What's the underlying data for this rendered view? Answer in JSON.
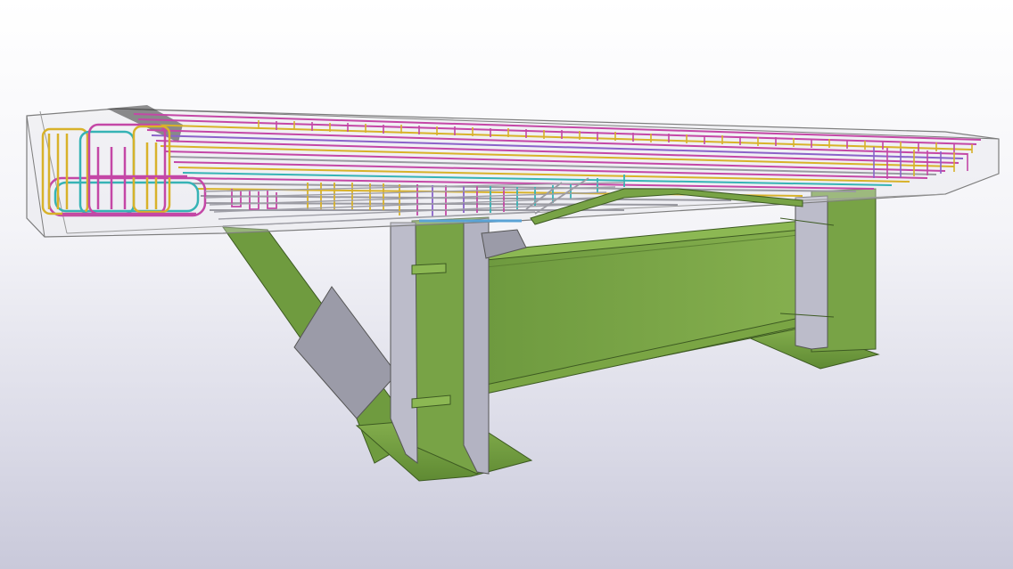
{
  "viewport": {
    "view": "3d-model",
    "background_top": "#ffffff",
    "background_bottom": "#c9c9da"
  },
  "model": {
    "colors": {
      "steel_girder": "#78a346",
      "steel_girder_dark": "#5c8233",
      "stiffener_plate": "#b9b9c7",
      "concrete_outline": "#8a8a8a",
      "rebar_magenta": "#c447a6",
      "rebar_yellow": "#d8b22a",
      "rebar_cyan": "#36b3b5",
      "rebar_purple": "#8a63c9",
      "rebar_gray": "#9a9aa2",
      "rebar_blue": "#5aa3d6"
    }
  }
}
